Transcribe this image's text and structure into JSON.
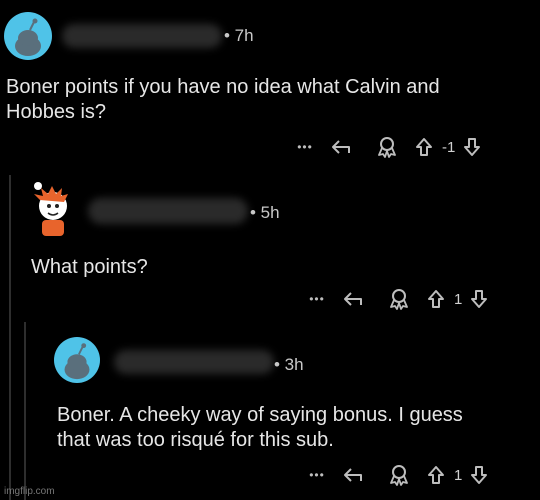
{
  "comments": [
    {
      "time": "• 7h",
      "body_line1": "Boner points if you have no idea what Calvin and",
      "body_line2": "Hobbes is?",
      "more": "•••",
      "score": "-1"
    },
    {
      "time": "• 5h",
      "body_line1": "What points?",
      "more": "•••",
      "score": "1"
    },
    {
      "time": "• 3h",
      "body_line1": "Boner. A cheeky way of saying bonus. I guess",
      "body_line2": "that was too risqué for this sub.",
      "more": "•••",
      "score": "1"
    }
  ],
  "watermark": "imgflip.com",
  "colors": {
    "background": "#000000",
    "avatar_blue": "#4fc3e8",
    "text": "#e6e6e6"
  }
}
